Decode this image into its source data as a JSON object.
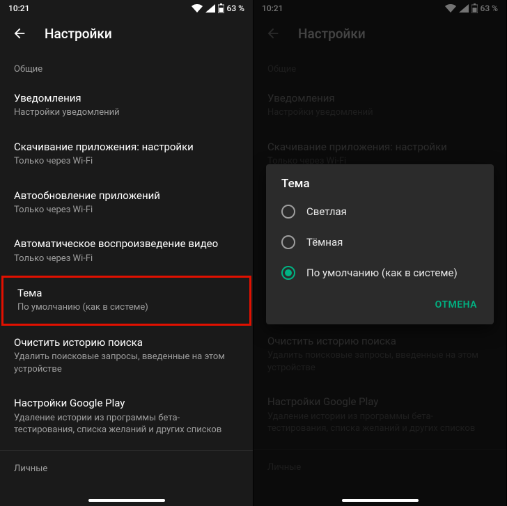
{
  "status": {
    "time": "10:21",
    "battery": "63 %"
  },
  "title": "Настройки",
  "sections": {
    "general": "Общие",
    "personal": "Личные"
  },
  "items": {
    "notifications": {
      "title": "Уведомления",
      "sub": "Настройки уведомлений"
    },
    "download": {
      "title": "Скачивание приложения: настройки",
      "sub": "Только через Wi-Fi"
    },
    "autoupdate": {
      "title": "Автообновление приложений",
      "sub": "Только через Wi-Fi"
    },
    "autoplay": {
      "title": "Автоматическое воспроизведение видео",
      "sub": "Только через Wi-Fi"
    },
    "theme": {
      "title": "Тема",
      "sub": "По умолчанию (как в системе)"
    },
    "clearHistory": {
      "title": "Очистить историю поиска",
      "sub": "Удалить поисковые запросы, введенные на этом устройстве"
    },
    "playSettings": {
      "title": "Настройки Google Play",
      "sub": "Удаление истории из программы бета-тестирования, списка желаний и других списков"
    }
  },
  "dialog": {
    "title": "Тема",
    "options": {
      "light": "Светлая",
      "dark": "Тёмная",
      "default": "По умолчанию (как в системе)"
    },
    "cancel": "ОТМЕНА"
  }
}
